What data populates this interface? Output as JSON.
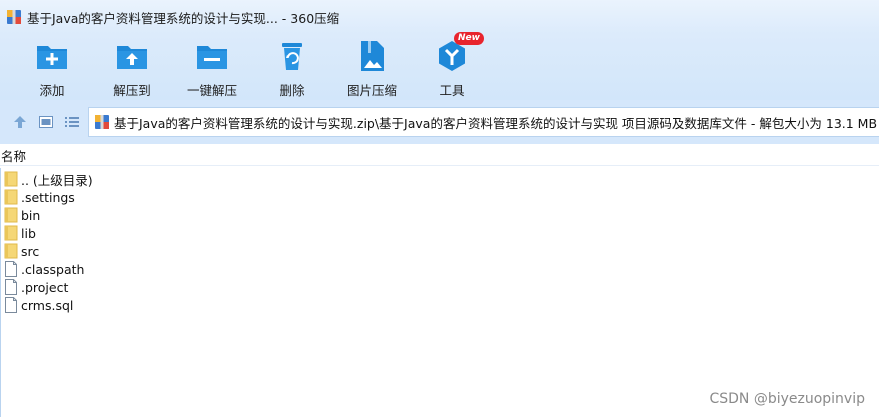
{
  "window": {
    "title": "基于Java的客户资料管理系统的设计与实现... - 360压缩"
  },
  "toolbar": {
    "items": [
      {
        "label": "添加",
        "icon": "add-icon"
      },
      {
        "label": "解压到",
        "icon": "extract-to-icon"
      },
      {
        "label": "一键解压",
        "icon": "one-click-extract-icon"
      },
      {
        "label": "删除",
        "icon": "delete-icon"
      },
      {
        "label": "图片压缩",
        "icon": "image-compress-icon"
      },
      {
        "label": "工具",
        "icon": "tools-icon",
        "badge": "New"
      }
    ]
  },
  "address": {
    "path": "基于Java的客户资料管理系统的设计与实现.zip\\基于Java的客户资料管理系统的设计与实现 项目源码及数据库文件 - 解包大小为 13.1 MB"
  },
  "list": {
    "column_name": "名称",
    "items": [
      {
        "name": ".. (上级目录)",
        "type": "folder"
      },
      {
        "name": ".settings",
        "type": "folder"
      },
      {
        "name": "bin",
        "type": "folder"
      },
      {
        "name": "lib",
        "type": "folder"
      },
      {
        "name": "src",
        "type": "folder"
      },
      {
        "name": ".classpath",
        "type": "file"
      },
      {
        "name": ".project",
        "type": "file"
      },
      {
        "name": "crms.sql",
        "type": "file"
      }
    ]
  },
  "watermark": "CSDN @biyezuopinvip",
  "colors": {
    "toolbar_blue": "#1e88d8",
    "badge_red": "#e8242d",
    "folder_yellow": "#f5d776"
  }
}
